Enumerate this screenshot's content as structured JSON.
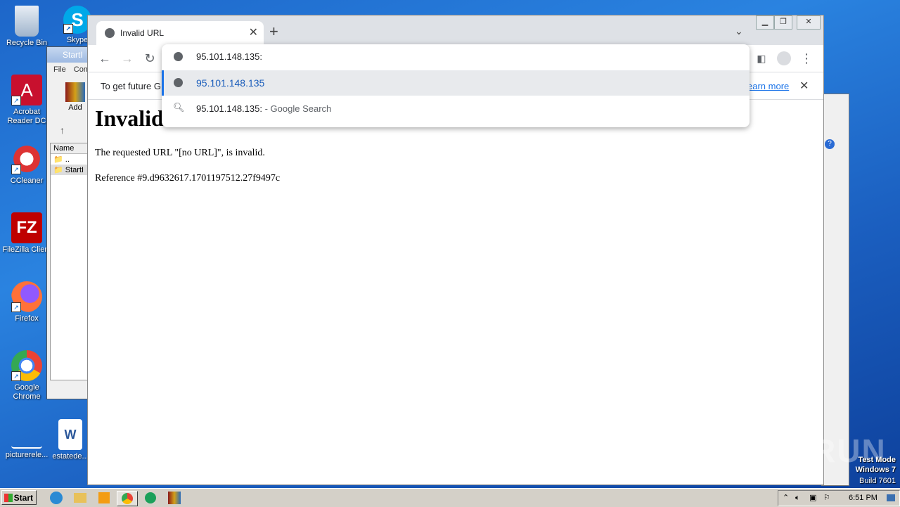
{
  "desktop": {
    "icons": [
      {
        "label": "Recycle Bin"
      },
      {
        "label": "Skype"
      },
      {
        "label": "Acrobat Reader DC"
      },
      {
        "label": "CCleaner"
      },
      {
        "label": "FileZilla Client"
      },
      {
        "label": "Firefox"
      },
      {
        "label": "Google Chrome"
      },
      {
        "label": "picturerele..."
      },
      {
        "label": "estatede..."
      }
    ]
  },
  "winrar": {
    "title": "StartI",
    "menu_file": "File",
    "menu_commands": "Com",
    "add_label": "Add",
    "col_name": "Name",
    "item_up": "..",
    "item_file": "StartI"
  },
  "chrome": {
    "tab_title": "Invalid URL",
    "omnibox_value": "95.101.148.135:",
    "suggestions": [
      {
        "text": "95.101.148.135",
        "kind": "url"
      },
      {
        "text": "95.101.148.135:",
        "suffix": " - Google Search",
        "kind": "search"
      }
    ],
    "infobar_text": "To get future G",
    "infobar_link": "earn more",
    "page": {
      "heading": "Invalid",
      "line1": "The requested URL \"[no URL]\", is invalid.",
      "line2": "Reference #9.d9632617.1701197512.27f9497c"
    }
  },
  "watermark": {
    "brand": "ANY RUN",
    "line1": "Test Mode",
    "line2": "Windows 7",
    "line3": "Build 7601"
  },
  "taskbar": {
    "start_label": "Start",
    "clock": "6:51 PM"
  },
  "colors": {
    "desktop_blue": "#1d66c9",
    "link_blue": "#1a73e8",
    "suggestion_blue": "#1a5dbb"
  }
}
